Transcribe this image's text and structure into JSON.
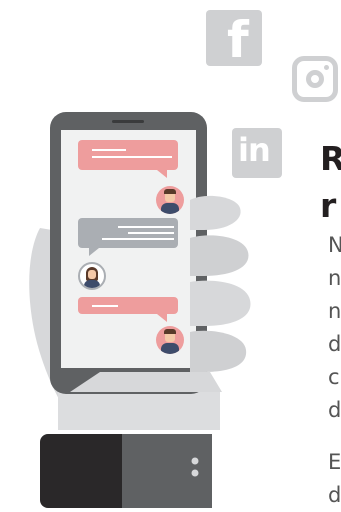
{
  "social_icons": [
    {
      "name": "facebook-icon",
      "glyph": "f"
    },
    {
      "name": "instagram-icon"
    },
    {
      "name": "linkedin-icon",
      "glyph": "in"
    }
  ],
  "heading_lines": [
    "R",
    "r"
  ],
  "body_lines": [
    "N",
    "n",
    "n",
    "d",
    "c",
    "d"
  ],
  "paragraph2_lines": [
    "E",
    "d"
  ],
  "chat": {
    "messages": [
      {
        "side": "right",
        "color": "pink",
        "avatar": "male"
      },
      {
        "side": "left",
        "color": "gray",
        "avatar": "female"
      },
      {
        "side": "right",
        "color": "pink",
        "avatar": "male"
      }
    ]
  },
  "colors": {
    "icon_gray": "#cfd0d2",
    "bubble_pink": "#ee9d9d",
    "bubble_gray": "#aaaeb3",
    "heading": "#231f20",
    "body_text": "#555555",
    "phone_body": "#5f6163",
    "sleeve": "#2a2829"
  }
}
